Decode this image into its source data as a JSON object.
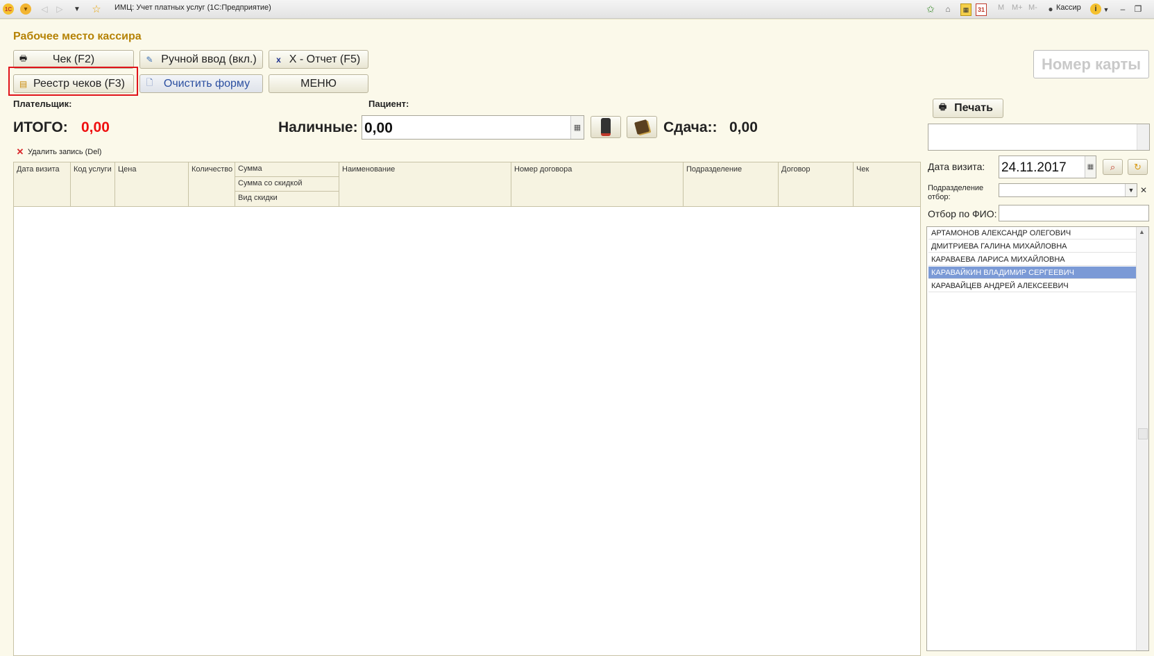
{
  "window": {
    "title": "ИМЦ: Учет платных услуг  (1С:Предприятие)",
    "toolbar_m": "M",
    "toolbar_mplus": "M+",
    "toolbar_mminus": "M-",
    "user": "Кассир"
  },
  "form": {
    "title": "Рабочее место кассира",
    "buttons": {
      "check": "Чек (F2)",
      "manual": "Ручной ввод (вкл.)",
      "xreport": "X - Отчет (F5)",
      "registry": "Реестр чеков (F3)",
      "clear": "Очистить форму",
      "menu": "МЕНЮ",
      "print": "Печать"
    },
    "card_number": "Номер карты",
    "payer_label": "Плательщик:",
    "patient_label": "Пациент:",
    "total_label": "ИТОГО:",
    "total_value": "0,00",
    "cash_label": "Наличные:",
    "cash_value": "0,00",
    "change_label": "Сдача::",
    "change_value": "0,00",
    "delete_record": "Удалить запись (Del)"
  },
  "table": {
    "columns": [
      "Дата визита",
      "Код услуги",
      "Цена",
      "Количество",
      "Сумма",
      "Сумма со скидкой",
      "Вид скидки",
      "Наименование",
      "Номер договора",
      "Подразделение",
      "Договор",
      "Чек"
    ]
  },
  "right_panel": {
    "visit_date_label": "Дата визита:",
    "visit_date_value": "24.11.2017",
    "department_filter_label": "Подразделение отбор:",
    "fio_filter_label": "Отбор по ФИО:",
    "patients": [
      "АРТАМОНОВ АЛЕКСАНДР ОЛЕГОВИЧ",
      "ДМИТРИЕВА ГАЛИНА МИХАЙЛОВНА",
      "КАРАВАЕВА ЛАРИСА МИХАЙЛОВНА",
      "КАРАВАЙКИН ВЛАДИМИР СЕРГЕЕВИЧ",
      "КАРАВАЙЦЕВ АНДРЕЙ АЛЕКСЕЕВИЧ"
    ],
    "selected_index": 3
  },
  "colors": {
    "accent_title": "#b58205",
    "total_red": "#ef1010",
    "highlight_box": "#e0131a",
    "selected_row": "#7b9ad6"
  }
}
